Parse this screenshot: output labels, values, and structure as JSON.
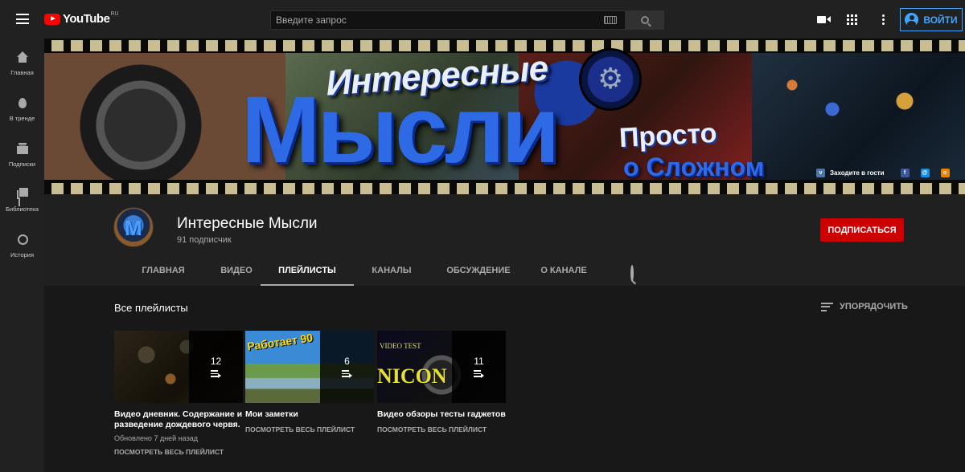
{
  "topbar": {
    "logo_text": "YouTube",
    "logo_region": "RU",
    "search_placeholder": "Введите запрос",
    "login_label": "ВОЙТИ"
  },
  "sidebar": {
    "items": [
      {
        "label": "Главная",
        "icon": "home-icon"
      },
      {
        "label": "В тренде",
        "icon": "fire-icon"
      },
      {
        "label": "Подписки",
        "icon": "subscriptions-icon"
      },
      {
        "label": "Библиотека",
        "icon": "library-icon"
      },
      {
        "label": "История",
        "icon": "history-icon"
      }
    ]
  },
  "banner": {
    "title_line1": "Интересные",
    "title_line2": "Мысли",
    "subtitle_line1": "Просто",
    "subtitle_line2": "о Сложном",
    "social_text": "Заходите в гости"
  },
  "channel": {
    "name": "Интересные Мысли",
    "subscribers": "91 подписчик",
    "subscribe_label": "ПОДПИСАТЬСЯ",
    "tabs": [
      "ГЛАВНАЯ",
      "ВИДЕО",
      "ПЛЕЙЛИСТЫ",
      "КАНАЛЫ",
      "ОБСУЖДЕНИЕ",
      "О КАНАЛЕ"
    ],
    "active_tab": "ПЛЕЙЛИСТЫ"
  },
  "content": {
    "section_title": "Все плейлисты",
    "sort_label": "УПОРЯДОЧИТЬ",
    "playlists": [
      {
        "count": "12",
        "title": "Видео дневник. Содержание и разведение дождевого червя.",
        "updated": "Обновлено 7 дней назад",
        "link": "ПОСМОТРЕТЬ ВЕСЬ ПЛЕЙЛИСТ"
      },
      {
        "count": "6",
        "title": "Мои заметки",
        "thumb_text": "Работает 90",
        "link": "ПОСМОТРЕТЬ ВЕСЬ ПЛЕЙЛИСТ"
      },
      {
        "count": "11",
        "title": "Видео обзоры тесты гаджетов",
        "thumb_text_top": "VIDEO TEST",
        "thumb_text_big": "NICON",
        "link": "ПОСМОТРЕТЬ ВЕСЬ ПЛЕЙЛИСТ"
      }
    ]
  },
  "colors": {
    "background": "#181818",
    "topbar": "#212121",
    "accent_blue": "#3ea6ff",
    "subscribe_red": "#cc0000"
  }
}
